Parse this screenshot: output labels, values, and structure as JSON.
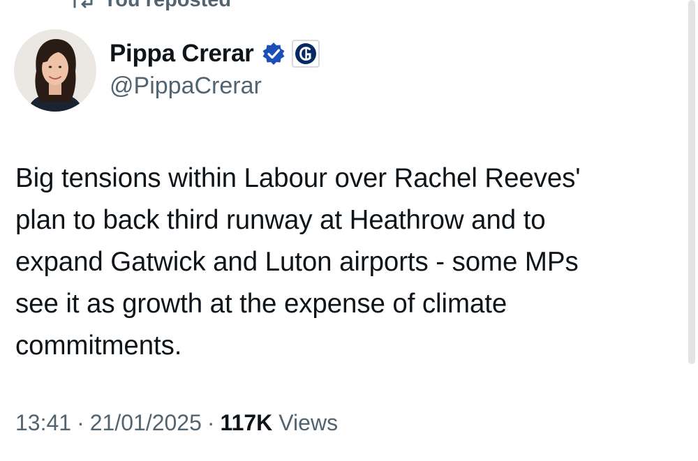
{
  "repost": {
    "icon": "repost-icon",
    "label": "You reposted"
  },
  "author": {
    "display_name": "Pippa Crerar",
    "handle": "@PippaCrerar",
    "verified_icon": "verified-badge-icon",
    "affiliate_icon": "guardian-logo-icon",
    "accent_color": "#1d9bf0"
  },
  "tweet": {
    "lines": [
      "Big tensions within Labour over Rachel Reeves'",
      "plan to back third runway at Heathrow and to",
      "expand Gatwick and Luton airports - some MPs",
      "see it as growth at the expense of climate",
      "commitments."
    ]
  },
  "meta": {
    "time": "13:41",
    "date": "21/01/2025",
    "separator": "·",
    "views_count": "117K",
    "views_label": "Views"
  }
}
